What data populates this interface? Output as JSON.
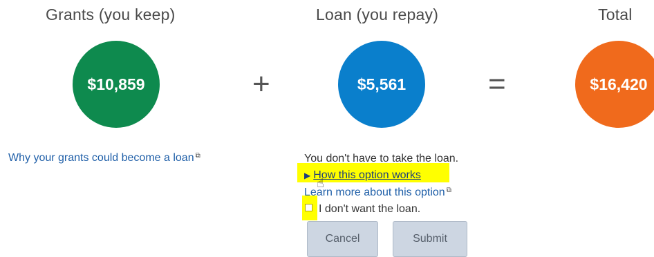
{
  "grants": {
    "title": "Grants (you keep)",
    "amount": "$10,859",
    "link": "Why your grants could become a loan",
    "color": "#0e8a4e"
  },
  "loan": {
    "title": "Loan (you repay)",
    "amount": "$5,561",
    "note": "You don't have to take the loan.",
    "how_link": "How this option works",
    "learn_link": "Learn more about this option",
    "checkbox_label": "I don't want the loan.",
    "color": "#0a7fcc"
  },
  "total": {
    "title": "Total",
    "amount": "$16,420",
    "color": "#f06a1c"
  },
  "operators": {
    "plus": "+",
    "equals": "="
  },
  "buttons": {
    "cancel": "Cancel",
    "submit": "Submit"
  },
  "icons": {
    "external_link": "external-link-icon",
    "triangle": "play-triangle-icon",
    "cursor": "hand-pointer-icon"
  }
}
